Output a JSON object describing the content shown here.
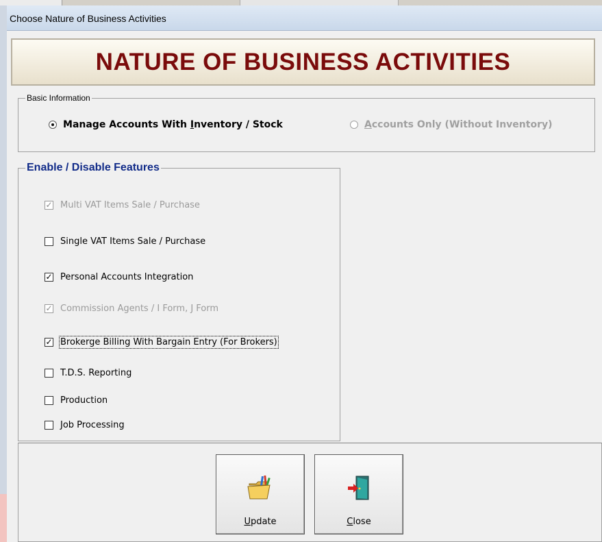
{
  "window": {
    "title": "Choose Nature of Business Activities"
  },
  "header": {
    "title": "NATURE OF BUSINESS ACTIVITIES"
  },
  "basic_info": {
    "legend": "Basic Information",
    "options": [
      {
        "key": "M",
        "pre": "",
        "rest": "anage Accounts With ",
        "ul": "I",
        "post": "nventory / Stock",
        "selected": true,
        "enabled": true
      },
      {
        "key": "A",
        "pre": "",
        "ul": "A",
        "post": "ccounts Only (Without Inventory)",
        "selected": false,
        "enabled": false
      }
    ]
  },
  "features": {
    "legend": "Enable / Disable Features",
    "items": [
      {
        "label": "Multi VAT Items Sale / Purchase",
        "checked": true,
        "enabled": false
      },
      {
        "label": "Single VAT Items Sale / Purchase",
        "checked": false,
        "enabled": true
      },
      {
        "label": "Personal Accounts Integration",
        "checked": true,
        "enabled": true
      },
      {
        "label": "Commission Agents / I Form, J Form",
        "checked": true,
        "enabled": false
      },
      {
        "label": "Brokerge Billing With Bargain Entry (For Brokers)",
        "checked": true,
        "enabled": true,
        "focused": true
      },
      {
        "label": "T.D.S. Reporting",
        "checked": false,
        "enabled": true
      },
      {
        "label": "Production",
        "checked": false,
        "enabled": true
      },
      {
        "label": "Job Processing",
        "checked": false,
        "enabled": true
      }
    ]
  },
  "buttons": {
    "update": {
      "ul": "U",
      "rest": "pdate",
      "icon": "folder-pencils-icon"
    },
    "close": {
      "ul": "C",
      "rest": "lose",
      "icon": "exit-door-icon"
    }
  },
  "colors": {
    "header_text": "#7a0b0b",
    "legend_blue": "#102a88"
  }
}
